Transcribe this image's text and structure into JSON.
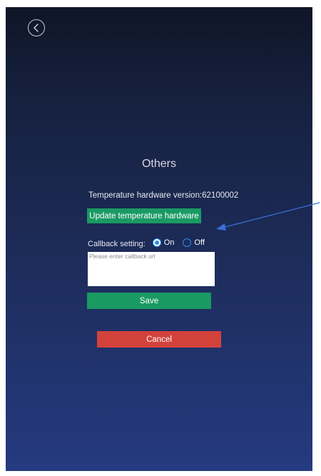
{
  "page": {
    "title": "Others",
    "hardware_version_text": "Temperature hardware version:62100002"
  },
  "buttons": {
    "update_label": "Update temperature hardware",
    "save_label": "Save",
    "cancel_label": "Cancel"
  },
  "callback": {
    "label": "Callback setting:",
    "options": [
      {
        "label": "On",
        "selected": true
      },
      {
        "label": "Off",
        "selected": false
      }
    ],
    "url_value": "",
    "url_placeholder": "Please enter callback url"
  },
  "icons": {
    "back": "chevron-left-circle-icon",
    "annotation": "arrow-annotation"
  },
  "colors": {
    "background_top": "#0f1527",
    "background_bottom": "#253a80",
    "primary_button": "#1a9a63",
    "cancel_button": "#d3423a",
    "radio_accent": "#2e8cf0",
    "annotation_arrow": "#3a6fd8"
  }
}
